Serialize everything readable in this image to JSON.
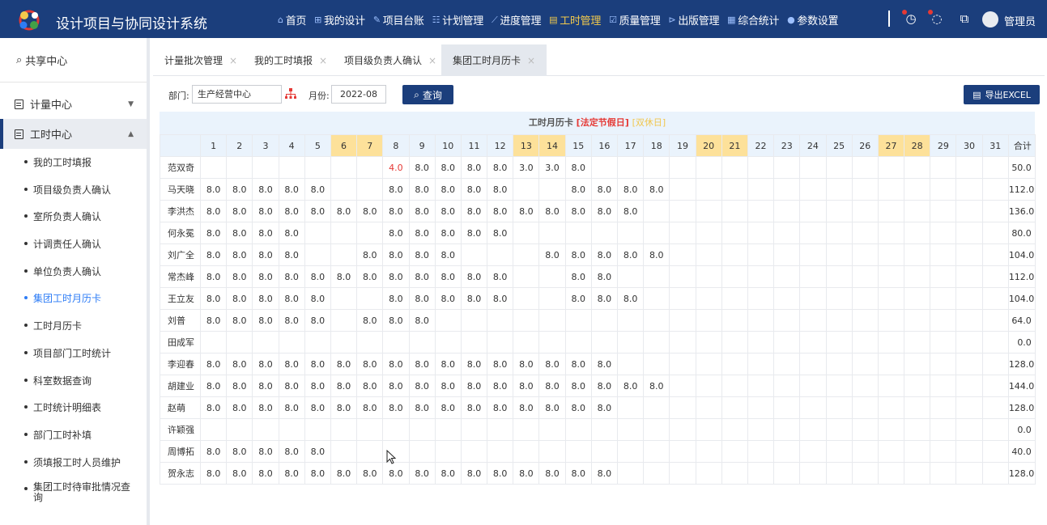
{
  "app": {
    "title": "设计项目与协同设计系统"
  },
  "nav": [
    {
      "icon": "⌂",
      "label": "首页",
      "active": false
    },
    {
      "icon": "⊞",
      "label": "我的设计",
      "active": false
    },
    {
      "icon": "✎",
      "label": "项目台账",
      "active": false
    },
    {
      "icon": "☷",
      "label": "计划管理",
      "active": false
    },
    {
      "icon": "⟋",
      "label": "进度管理",
      "active": false
    },
    {
      "icon": "▤",
      "label": "工时管理",
      "active": true
    },
    {
      "icon": "☑",
      "label": "质量管理",
      "active": false
    },
    {
      "icon": "⊳",
      "label": "出版管理",
      "active": false
    },
    {
      "icon": "▦",
      "label": "综合统计",
      "active": false
    },
    {
      "icon": "●",
      "label": "参数设置",
      "active": false
    }
  ],
  "user": {
    "name": "管理员"
  },
  "sidebar": {
    "share_label": "共享中心",
    "groups": [
      {
        "label": "计量中心",
        "arrow": "▼",
        "active": false
      },
      {
        "label": "工时中心",
        "arrow": "▲",
        "active": true
      }
    ],
    "items": [
      {
        "label": "我的工时填报",
        "active": false
      },
      {
        "label": "项目级负责人确认",
        "active": false
      },
      {
        "label": "室所负责人确认",
        "active": false
      },
      {
        "label": "计调责任人确认",
        "active": false
      },
      {
        "label": "单位负责人确认",
        "active": false
      },
      {
        "label": "集团工时月历卡",
        "active": true
      },
      {
        "label": "工时月历卡",
        "active": false
      },
      {
        "label": "项目部门工时统计",
        "active": false
      },
      {
        "label": "科室数据查询",
        "active": false
      },
      {
        "label": "工时统计明细表",
        "active": false
      },
      {
        "label": "部门工时补填",
        "active": false
      },
      {
        "label": "须填报工时人员维护",
        "active": false
      },
      {
        "label": "集团工时待审批情况查询",
        "active": false
      }
    ]
  },
  "tabs": [
    {
      "label": "计量批次管理",
      "close": "×",
      "active": false
    },
    {
      "label": "我的工时填报",
      "close": "×",
      "active": false
    },
    {
      "label": "项目级负责人确认",
      "close": "×",
      "active": false
    },
    {
      "label": "集团工时月历卡",
      "close": "×",
      "active": true
    }
  ],
  "filter": {
    "dept_label": "部门:",
    "dept_value": "生产经营中心",
    "month_label": "月份:",
    "month_value": "2022-08",
    "query_label": "查询",
    "export_label": "导出EXCEL"
  },
  "calendar": {
    "title": "工时月历卡",
    "holiday_legend": "[法定节假日]",
    "weekend_legend": "[双休日]",
    "total_header": "合计",
    "days": [
      "1",
      "2",
      "3",
      "4",
      "5",
      "6",
      "7",
      "8",
      "9",
      "10",
      "11",
      "12",
      "13",
      "14",
      "15",
      "16",
      "17",
      "18",
      "19",
      "20",
      "21",
      "22",
      "23",
      "24",
      "25",
      "26",
      "27",
      "28",
      "29",
      "30",
      "31"
    ],
    "highlight_days": [
      6,
      7,
      13,
      14,
      20,
      21,
      27,
      28
    ],
    "red_cells": [
      [
        0,
        8
      ]
    ],
    "rows": [
      {
        "name": "范双奇",
        "hours": {
          "8": "4.0",
          "9": "8.0",
          "10": "8.0",
          "11": "8.0",
          "12": "8.0",
          "13": "3.0",
          "14": "3.0",
          "15": "8.0"
        },
        "total": "50.0"
      },
      {
        "name": "马天晓",
        "hours": {
          "1": "8.0",
          "2": "8.0",
          "3": "8.0",
          "4": "8.0",
          "5": "8.0",
          "8": "8.0",
          "9": "8.0",
          "10": "8.0",
          "11": "8.0",
          "12": "8.0",
          "15": "8.0",
          "16": "8.0",
          "17": "8.0",
          "18": "8.0"
        },
        "total": "112.0"
      },
      {
        "name": "李洪杰",
        "hours": {
          "1": "8.0",
          "2": "8.0",
          "3": "8.0",
          "4": "8.0",
          "5": "8.0",
          "6": "8.0",
          "7": "8.0",
          "8": "8.0",
          "9": "8.0",
          "10": "8.0",
          "11": "8.0",
          "12": "8.0",
          "13": "8.0",
          "14": "8.0",
          "15": "8.0",
          "16": "8.0",
          "17": "8.0"
        },
        "total": "136.0"
      },
      {
        "name": "何永冕",
        "hours": {
          "1": "8.0",
          "2": "8.0",
          "3": "8.0",
          "4": "8.0",
          "8": "8.0",
          "9": "8.0",
          "10": "8.0",
          "11": "8.0",
          "12": "8.0"
        },
        "total": "80.0"
      },
      {
        "name": "刘广全",
        "hours": {
          "1": "8.0",
          "2": "8.0",
          "3": "8.0",
          "4": "8.0",
          "7": "8.0",
          "8": "8.0",
          "9": "8.0",
          "10": "8.0",
          "14": "8.0",
          "15": "8.0",
          "16": "8.0",
          "17": "8.0",
          "18": "8.0"
        },
        "total": "104.0"
      },
      {
        "name": "常杰峰",
        "hours": {
          "1": "8.0",
          "2": "8.0",
          "3": "8.0",
          "4": "8.0",
          "5": "8.0",
          "6": "8.0",
          "7": "8.0",
          "8": "8.0",
          "9": "8.0",
          "10": "8.0",
          "11": "8.0",
          "12": "8.0",
          "15": "8.0",
          "16": "8.0"
        },
        "total": "112.0"
      },
      {
        "name": "王立友",
        "hours": {
          "1": "8.0",
          "2": "8.0",
          "3": "8.0",
          "4": "8.0",
          "5": "8.0",
          "8": "8.0",
          "9": "8.0",
          "10": "8.0",
          "11": "8.0",
          "12": "8.0",
          "15": "8.0",
          "16": "8.0",
          "17": "8.0"
        },
        "total": "104.0"
      },
      {
        "name": "刘普",
        "hours": {
          "1": "8.0",
          "2": "8.0",
          "3": "8.0",
          "4": "8.0",
          "5": "8.0",
          "7": "8.0",
          "8": "8.0",
          "9": "8.0"
        },
        "total": "64.0"
      },
      {
        "name": "田成军",
        "hours": {},
        "total": "0.0"
      },
      {
        "name": "李迎春",
        "hours": {
          "1": "8.0",
          "2": "8.0",
          "3": "8.0",
          "4": "8.0",
          "5": "8.0",
          "6": "8.0",
          "7": "8.0",
          "8": "8.0",
          "9": "8.0",
          "10": "8.0",
          "11": "8.0",
          "12": "8.0",
          "13": "8.0",
          "14": "8.0",
          "15": "8.0",
          "16": "8.0"
        },
        "total": "128.0"
      },
      {
        "name": "胡建业",
        "hours": {
          "1": "8.0",
          "2": "8.0",
          "3": "8.0",
          "4": "8.0",
          "5": "8.0",
          "6": "8.0",
          "7": "8.0",
          "8": "8.0",
          "9": "8.0",
          "10": "8.0",
          "11": "8.0",
          "12": "8.0",
          "13": "8.0",
          "14": "8.0",
          "15": "8.0",
          "16": "8.0",
          "17": "8.0",
          "18": "8.0"
        },
        "total": "144.0"
      },
      {
        "name": "赵萌",
        "hours": {
          "1": "8.0",
          "2": "8.0",
          "3": "8.0",
          "4": "8.0",
          "5": "8.0",
          "6": "8.0",
          "7": "8.0",
          "8": "8.0",
          "9": "8.0",
          "10": "8.0",
          "11": "8.0",
          "12": "8.0",
          "13": "8.0",
          "14": "8.0",
          "15": "8.0",
          "16": "8.0"
        },
        "total": "128.0"
      },
      {
        "name": "许颖强",
        "hours": {},
        "total": "0.0"
      },
      {
        "name": "周博拓",
        "hours": {
          "1": "8.0",
          "2": "8.0",
          "3": "8.0",
          "4": "8.0",
          "5": "8.0"
        },
        "total": "40.0"
      },
      {
        "name": "贺永志",
        "hours": {
          "1": "8.0",
          "2": "8.0",
          "3": "8.0",
          "4": "8.0",
          "5": "8.0",
          "6": "8.0",
          "7": "8.0",
          "8": "8.0",
          "9": "8.0",
          "10": "8.0",
          "11": "8.0",
          "12": "8.0",
          "13": "8.0",
          "14": "8.0",
          "15": "8.0",
          "16": "8.0"
        },
        "total": "128.0"
      }
    ]
  },
  "colors": {
    "header_bg": "#1b3e7c",
    "active_nav": "#f2c94c",
    "holiday": "#e53935",
    "weekend": "#f0c64e",
    "highlight_col": "#fde19a",
    "link_active": "#2d7cf6"
  }
}
